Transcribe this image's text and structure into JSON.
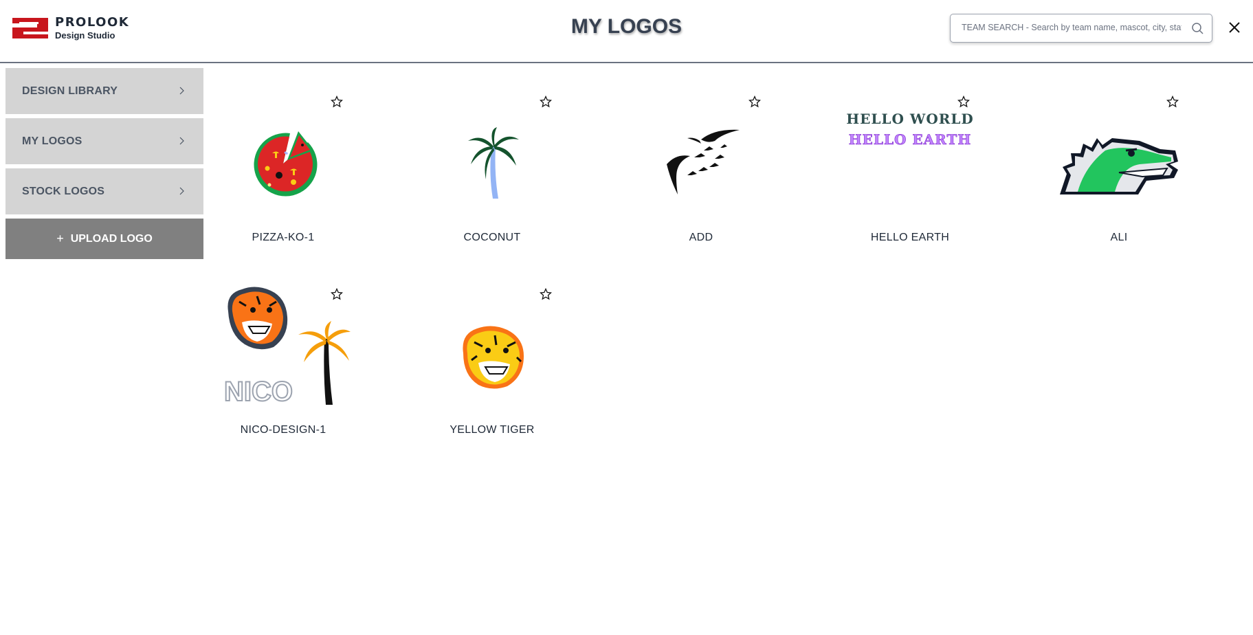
{
  "brand": {
    "name": "PROLOOK",
    "subtitle": "Design Studio",
    "accent": "#c8161d"
  },
  "header": {
    "title": "MY LOGOS"
  },
  "search": {
    "placeholder": "TEAM SEARCH - Search by team name, mascot, city, state, etc."
  },
  "sidebar": {
    "items": [
      {
        "label": "DESIGN LIBRARY"
      },
      {
        "label": "MY LOGOS"
      },
      {
        "label": "STOCK LOGOS"
      }
    ],
    "upload": {
      "plus": "+",
      "label": "UPLOAD LOGO"
    }
  },
  "logos": [
    {
      "name": "PIZZA-KO-1",
      "icon": "pizza-logo"
    },
    {
      "name": "COCONUT",
      "icon": "palm-tree-logo"
    },
    {
      "name": "ADD",
      "icon": "birds-logo"
    },
    {
      "name": "HELLO EARTH",
      "icon": "hello-text-logo",
      "art_line1": "HELLO WORLD",
      "art_line2": "HELLO EARTH"
    },
    {
      "name": "ALI",
      "icon": "alligator-logo"
    },
    {
      "name": "NICO-DESIGN-1",
      "icon": "tiger-palm-logo",
      "art_text": "NICO"
    },
    {
      "name": "YELLOW TIGER",
      "icon": "yellow-tiger-logo"
    }
  ],
  "colors": {
    "sidebar_bg": "#d4d4d4",
    "upload_bg": "#808080",
    "header_border": "#6b7280"
  }
}
